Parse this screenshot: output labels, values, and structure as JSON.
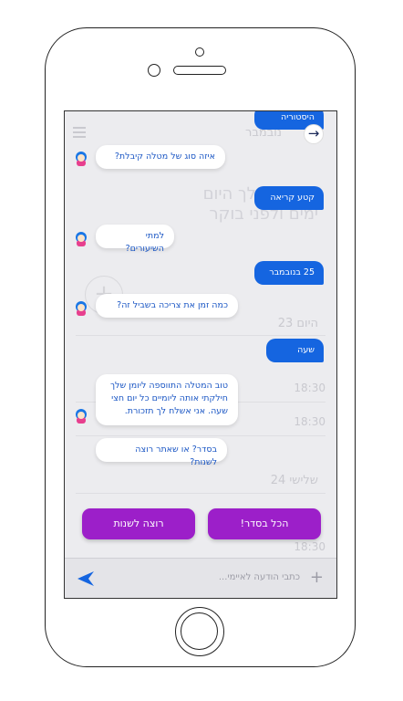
{
  "background_app": {
    "title": "נובמבר",
    "heading_line1": "התיומן שלך היום",
    "heading_line2": "ימים ולפני בוקר",
    "day1": "היום 23",
    "time1": "18:30",
    "time2": "18:30",
    "day2": "שלישי 24",
    "time3": "18:30"
  },
  "messages": [
    {
      "from": "user",
      "text": "היסטוריה"
    },
    {
      "from": "bot",
      "text": "איזה סוג של מטלה קיבלת?"
    },
    {
      "from": "user",
      "text": "קטע קריאה"
    },
    {
      "from": "bot",
      "text": "למתי השיעורים?"
    },
    {
      "from": "user",
      "text": "25 בנובמבר"
    },
    {
      "from": "bot",
      "text": "כמה זמן את צריכה בשביל זה?"
    },
    {
      "from": "user",
      "text": "שעה"
    },
    {
      "from": "bot",
      "text": "טוב המטלה התווספה ליומן שלך חילקתי אותה ליומיים כל יום חצי שעה. אני אשלח לך תזכורת."
    },
    {
      "from": "bot",
      "text": "בסדר? או שאתר רוצה לשנות?"
    }
  ],
  "quick_replies": {
    "ok": "הכל בסדר!",
    "change": "רוצה לשנות"
  },
  "input": {
    "placeholder": "כתבי הודעה לאיימי..."
  },
  "colors": {
    "user_bubble": "#1565e0",
    "bot_text": "#1a56c4",
    "quick_reply": "#9c1fc9",
    "send_icon": "#1565e0"
  },
  "icons": [
    "arrow-right-icon",
    "send-icon",
    "plus-icon",
    "bot-avatar-icon",
    "menu-icon"
  ]
}
